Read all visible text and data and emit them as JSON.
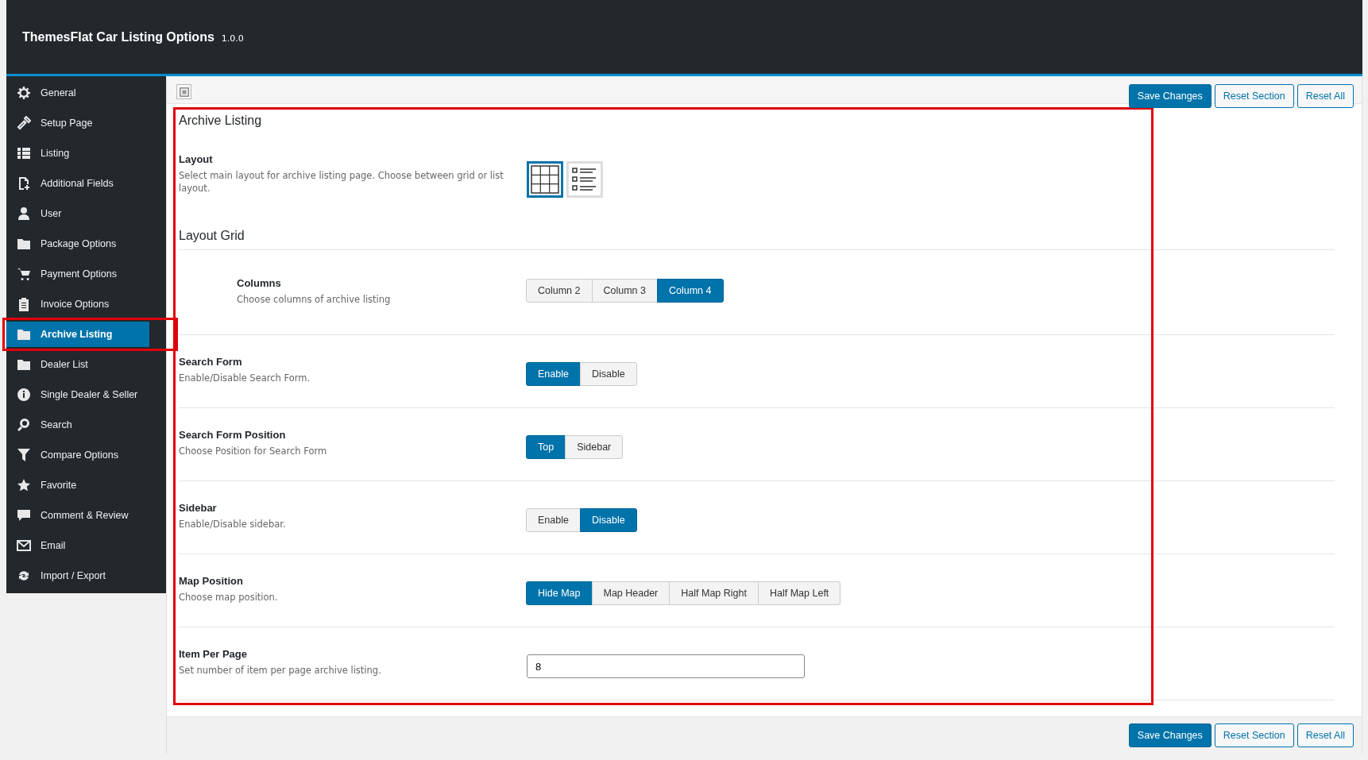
{
  "header": {
    "title": "ThemesFlat Car Listing Options",
    "version": "1.0.0"
  },
  "sidebar": {
    "items": [
      {
        "label": "General",
        "selected": false,
        "annotated": false
      },
      {
        "label": "Setup Page",
        "selected": false,
        "annotated": false
      },
      {
        "label": "Listing",
        "selected": false,
        "annotated": false
      },
      {
        "label": "Additional Fields",
        "selected": false,
        "annotated": false
      },
      {
        "label": "User",
        "selected": false,
        "annotated": false
      },
      {
        "label": "Package Options",
        "selected": false,
        "annotated": false
      },
      {
        "label": "Payment Options",
        "selected": false,
        "annotated": false
      },
      {
        "label": "Invoice Options",
        "selected": false,
        "annotated": false
      },
      {
        "label": "Archive Listing",
        "selected": true,
        "annotated": true
      },
      {
        "label": "Dealer List",
        "selected": false,
        "annotated": false
      },
      {
        "label": "Single Dealer & Seller",
        "selected": false,
        "annotated": false
      },
      {
        "label": "Search",
        "selected": false,
        "annotated": false
      },
      {
        "label": "Compare Options",
        "selected": false,
        "annotated": false
      },
      {
        "label": "Favorite",
        "selected": false,
        "annotated": false
      },
      {
        "label": "Comment & Review",
        "selected": false,
        "annotated": false
      },
      {
        "label": "Email",
        "selected": false,
        "annotated": false
      },
      {
        "label": "Import / Export",
        "selected": false,
        "annotated": false
      }
    ]
  },
  "top_actions": [
    "Save Changes",
    "Reset Section",
    "Reset All"
  ],
  "section": {
    "title": "Archive Listing",
    "annotated": true,
    "fields": [
      {
        "kind": "image_select",
        "label": "Layout",
        "description": "Select main layout for archive listing page. Choose between grid or list layout.",
        "options": [
          {
            "selected": true
          },
          {
            "selected": false
          }
        ]
      },
      {
        "kind": "subheading",
        "label": "Layout Grid"
      },
      {
        "kind": "button_set",
        "indented": true,
        "label": "Columns",
        "description": "Choose columns of archive listing",
        "options": [
          {
            "label": "Column 2",
            "selected": false
          },
          {
            "label": "Column 3",
            "selected": false
          },
          {
            "label": "Column 4",
            "selected": true
          }
        ]
      },
      {
        "kind": "button_set",
        "indented": false,
        "label": "Search Form",
        "description": "Enable/Disable Search Form.",
        "options": [
          {
            "label": "Enable",
            "selected": true
          },
          {
            "label": "Disable",
            "selected": false
          }
        ]
      },
      {
        "kind": "button_set",
        "indented": false,
        "label": "Search Form Position",
        "description": "Choose Position for Search Form",
        "options": [
          {
            "label": "Top",
            "selected": true
          },
          {
            "label": "Sidebar",
            "selected": false
          }
        ]
      },
      {
        "kind": "button_set",
        "indented": false,
        "label": "Sidebar",
        "description": "Enable/Disable sidebar.",
        "options": [
          {
            "label": "Enable",
            "selected": false
          },
          {
            "label": "Disable",
            "selected": true
          }
        ]
      },
      {
        "kind": "button_set",
        "indented": false,
        "label": "Map Position",
        "description": "Choose map position.",
        "options": [
          {
            "label": "Hide Map",
            "selected": true
          },
          {
            "label": "Map Header",
            "selected": false
          },
          {
            "label": "Half Map Right",
            "selected": false
          },
          {
            "label": "Half Map Left",
            "selected": false
          }
        ]
      },
      {
        "kind": "text",
        "label": "Item Per Page",
        "description": "Set number of item per page archive listing.",
        "value": "8"
      }
    ]
  },
  "bottom_actions": [
    "Save Changes",
    "Reset Section",
    "Reset All"
  ]
}
